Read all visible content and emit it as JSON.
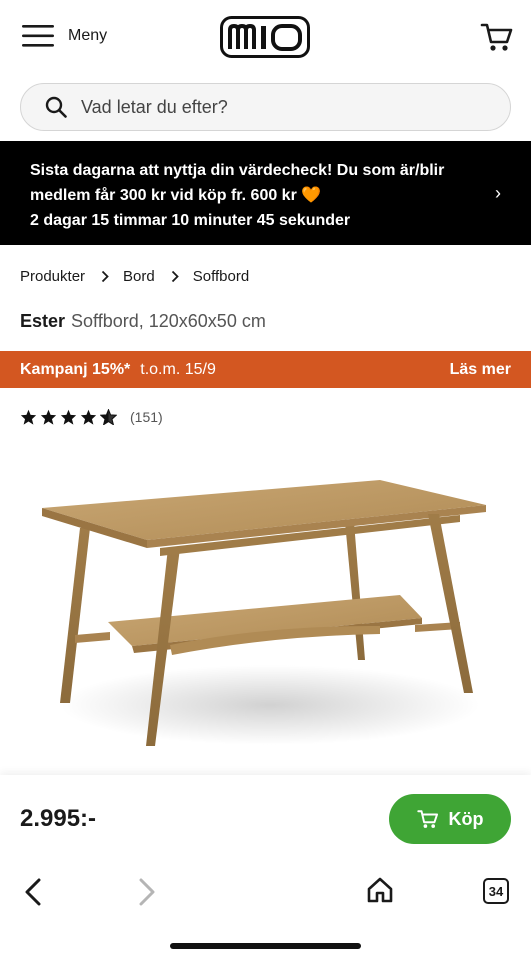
{
  "header": {
    "menu_label": "Meny",
    "logo_text": "mio",
    "icons": [
      "hamburger-icon",
      "cart-icon"
    ]
  },
  "search": {
    "placeholder": "Vad letar du efter?",
    "icon": "search-icon"
  },
  "promo": {
    "line1": "Sista dagarna att nyttja din värdecheck! Du som är/blir",
    "line2": "medlem får 300 kr vid köp fr. 600 kr",
    "heart": "🧡",
    "countdown": "2 dagar 15 timmar 10 minuter 45 sekunder",
    "chevron": "›"
  },
  "breadcrumb": [
    "Produkter",
    "Bord",
    "Soffbord"
  ],
  "product": {
    "brand": "Ester",
    "description": "Soffbord, 120x60x50 cm",
    "rating_stars": 4.5,
    "review_count": "(151)",
    "price": "2.995:-",
    "buy_label": "Köp"
  },
  "campaign": {
    "label": "Kampanj 15%*",
    "date": "t.o.m. 15/9",
    "more": "Läs mer",
    "color": "#d35721"
  },
  "browser": {
    "tab_count": "34"
  },
  "colors": {
    "buy_green": "#3fa535",
    "promo_bg": "#000000"
  }
}
